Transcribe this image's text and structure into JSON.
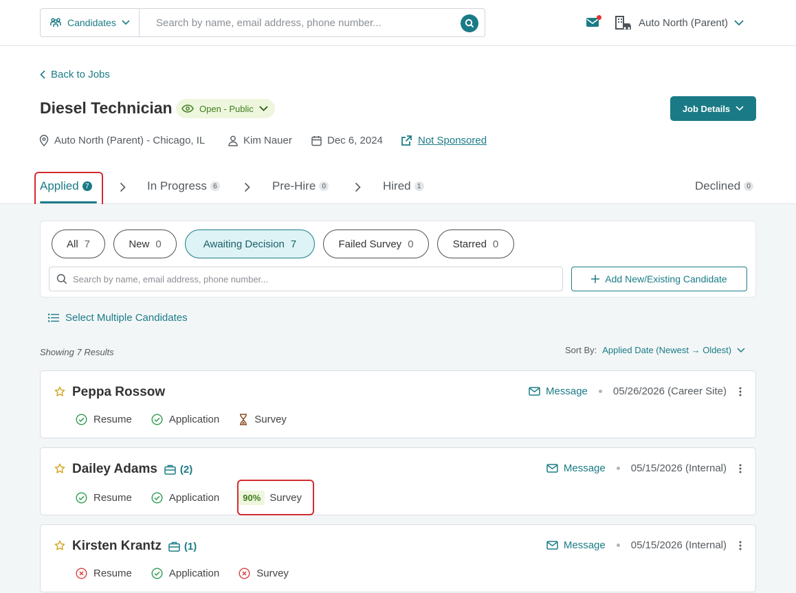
{
  "topbar": {
    "scope_label": "Candidates",
    "search_placeholder": "Search by name, email address, phone number...",
    "org_name": "Auto North (Parent)"
  },
  "header": {
    "back_label": "Back to Jobs",
    "job_title": "Diesel Technician",
    "status": "Open - Public",
    "job_details_label": "Job Details",
    "location": "Auto North (Parent) - Chicago, IL",
    "recruiter": "Kim Nauer",
    "date": "Dec 6, 2024",
    "sponsorship": "Not Sponsored"
  },
  "tabs": [
    {
      "label": "Applied",
      "count": "7"
    },
    {
      "label": "In Progress",
      "count": "6"
    },
    {
      "label": "Pre-Hire",
      "count": "0"
    },
    {
      "label": "Hired",
      "count": "1"
    },
    {
      "label": "Declined",
      "count": "0"
    }
  ],
  "filters": [
    {
      "label": "All",
      "count": "7"
    },
    {
      "label": "New",
      "count": "0"
    },
    {
      "label": "Awaiting Decision",
      "count": "7"
    },
    {
      "label": "Failed Survey",
      "count": "0"
    },
    {
      "label": "Starred",
      "count": "0"
    }
  ],
  "list": {
    "search_placeholder": "Search by name, email address, phone number...",
    "add_label": "Add New/Existing Candidate",
    "select_multiple_label": "Select Multiple Candidates",
    "showing": "Showing 7 Results",
    "sort_label": "Sort By:",
    "sort_value": "Applied Date (Newest → Oldest)"
  },
  "candidates": [
    {
      "name": "Peppa Rossow",
      "jobs": "",
      "message": "Message",
      "applied": "05/26/2026 (Career Site)",
      "resume": "Resume",
      "application": "Application",
      "survey": "Survey",
      "survey_pct": ""
    },
    {
      "name": "Dailey Adams",
      "jobs": "(2)",
      "message": "Message",
      "applied": "05/15/2026 (Internal)",
      "resume": "Resume",
      "application": "Application",
      "survey": "Survey",
      "survey_pct": "90%"
    },
    {
      "name": "Kirsten Krantz",
      "jobs": "(1)",
      "message": "Message",
      "applied": "05/15/2026 (Internal)",
      "resume": "Resume",
      "application": "Application",
      "survey": "Survey",
      "survey_pct": ""
    }
  ],
  "colors": {
    "accent": "#1a7b86",
    "success": "#2e9b4f",
    "error": "#d94040",
    "highlight": "#d42a2e"
  }
}
